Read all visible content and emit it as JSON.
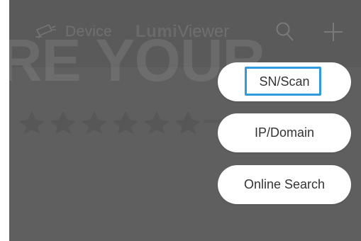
{
  "header": {
    "device_label": "Device",
    "app_title_bold": "Lumi",
    "app_title_rest": "Viewer"
  },
  "watermark": "RE YOUR",
  "menu": {
    "items": [
      {
        "label": "SN/Scan",
        "highlighted": true
      },
      {
        "label": "IP/Domain"
      },
      {
        "label": "Online Search"
      }
    ]
  },
  "colors": {
    "overlay": "#5f5f5f",
    "menu_bg": "#ffffff",
    "highlight": "#2f9bdc"
  }
}
